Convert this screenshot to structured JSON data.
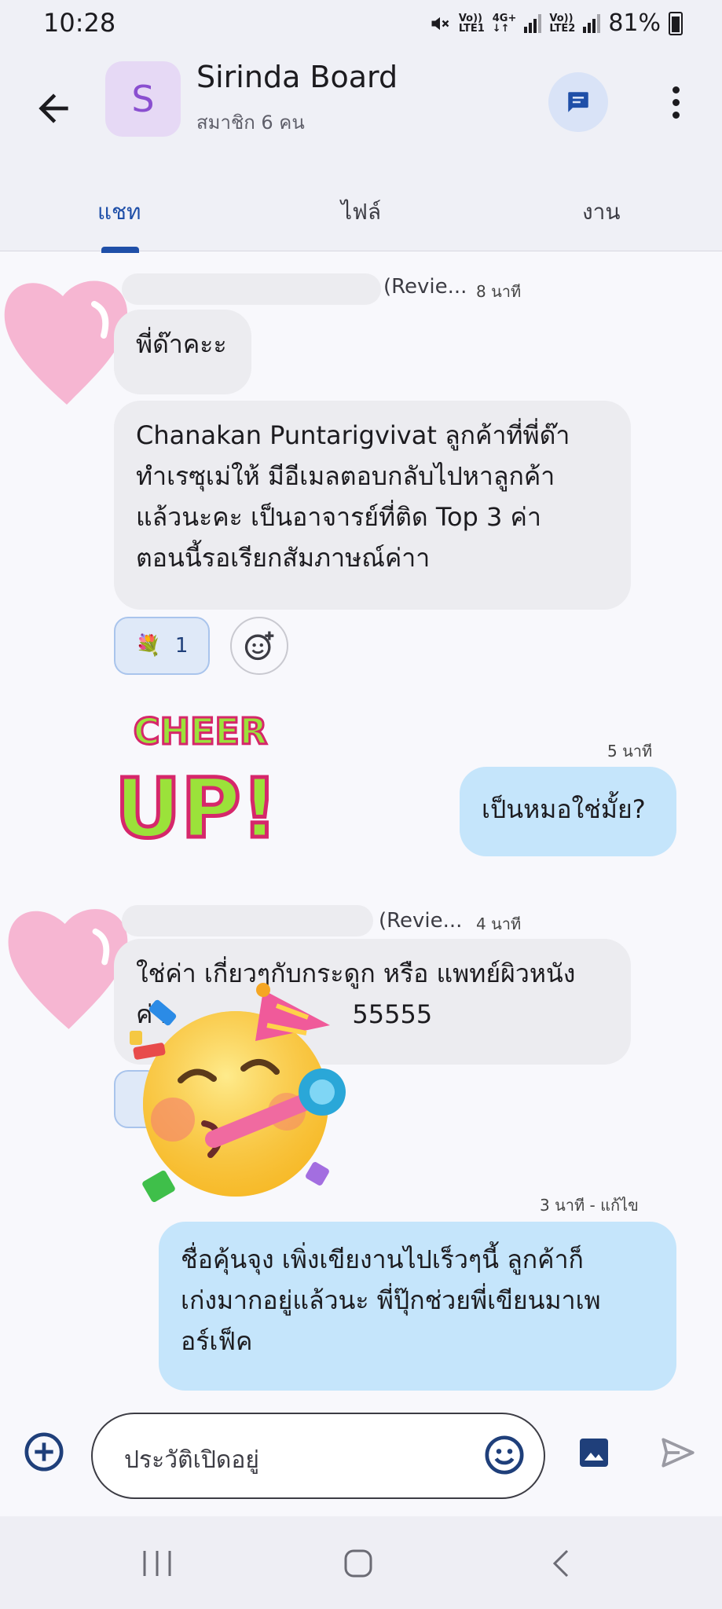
{
  "status_bar": {
    "time": "10:28",
    "sim1_top": "Vo))",
    "sim1_bottom": "LTE1",
    "net_top": "4G+",
    "sim2_top": "Vo))",
    "sim2_bottom": "LTE2",
    "battery": "81%"
  },
  "header": {
    "avatar_letter": "S",
    "title": "Sirinda Board",
    "subtitle": "สมาชิก 6 คน",
    "icons": [
      "back-arrow-icon",
      "chat-thread-icon",
      "more-vert-icon"
    ]
  },
  "tabs": [
    {
      "label": "แชท",
      "active": true
    },
    {
      "label": "ไฟล์",
      "active": false
    },
    {
      "label": "งาน",
      "active": false
    }
  ],
  "messages": {
    "m1": {
      "sender": "(Revie...",
      "time": "8 นาที",
      "text1": "พี่ด๊าคะะ",
      "text2": "Chanakan Puntarigvivat  ลูกค้าที่พี่ด๊า\nทำเรซุเม่ให้  มีอีเมลตอบกลับไปหาลูกค้า\nแล้วนะคะ เป็นอาจารย์ที่ติด Top 3 ค่า\nตอนนี้รอเรียกสัมภาษณ์ค่าา",
      "reaction_emoji": "💐",
      "reaction_count": "1"
    },
    "m2": {
      "time": "5 นาที",
      "text": "เป็นหมอใช่มั้ย?",
      "sticker_line1": "CHEER",
      "sticker_line2": "UP!"
    },
    "m3": {
      "sender": "(Revie...",
      "time": "4 นาที",
      "line1": "ใช่ค่า เกี่ยวๆกับกระดูก หรือ แพทย์ผิวหนัง",
      "line2": "ค่า",
      "line2_tail": "55555"
    },
    "m4": {
      "time": "3 นาที - แก้ไข",
      "text": "ชื่อคุ้นจุง เพิ่งเขียงานไปเร็วๆนี้ ลูกค้าก็\nเก่งมากอยู่แล้วนะ พี่ปุ๊กช่วยพี่เขียนมาเพ\nอร์เฟ็ค"
    }
  },
  "composer": {
    "placeholder": "ประวัติเปิดอยู่"
  },
  "colors": {
    "header_bg": "#eff0f6",
    "accent": "#1f4fa8",
    "own_bubble": "#c5e5fb",
    "other_bubble": "#ececf0"
  }
}
